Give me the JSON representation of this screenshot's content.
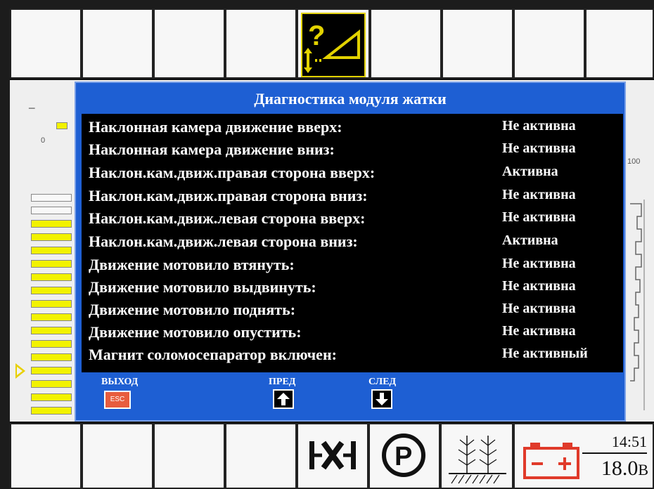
{
  "dialog": {
    "title": "Диагностика модуля жатки",
    "rows": [
      {
        "label": "Наклонная камера движение вверх:",
        "status": "Не активна"
      },
      {
        "label": "Наклонная камера движение вниз:",
        "status": "Не активна"
      },
      {
        "label": "Наклон.кам.движ.правая сторона вверх:",
        "status": "Активна"
      },
      {
        "label": "Наклон.кам.движ.правая сторона вниз:",
        "status": "Не активна"
      },
      {
        "label": "Наклон.кам.движ.левая сторона вверх:",
        "status": "Не активна"
      },
      {
        "label": "Наклон.кам.движ.левая сторона вниз:",
        "status": "Активна"
      },
      {
        "label": "Движение мотовило втянуть:",
        "status": "Не активна"
      },
      {
        "label": "Движение мотовило выдвинуть:",
        "status": "Не активна"
      },
      {
        "label": "Движение мотовило поднять:",
        "status": "Не активна"
      },
      {
        "label": "Движение мотовило опустить:",
        "status": "Не активна"
      },
      {
        "label": "Магнит соломосепаратор включен:",
        "status": "Не активный"
      }
    ],
    "softkeys": {
      "exit_label": "ВЫХОД",
      "exit_key": "ESC",
      "prev_label": "ПРЕД",
      "next_label": "СЛЕД"
    }
  },
  "gauge": {
    "left_min": "0",
    "right_max": "100",
    "left_dash": "−"
  },
  "status": {
    "time": "14:51",
    "voltage": "18.0",
    "voltage_unit": "В"
  },
  "header_icon": "header-diagnostics-question-icon",
  "colors": {
    "dialog_blue": "#1e5fd3",
    "active_yellow": "#e2d200",
    "esc_orange": "#e85d3e",
    "battery_red": "#e03a2a"
  }
}
